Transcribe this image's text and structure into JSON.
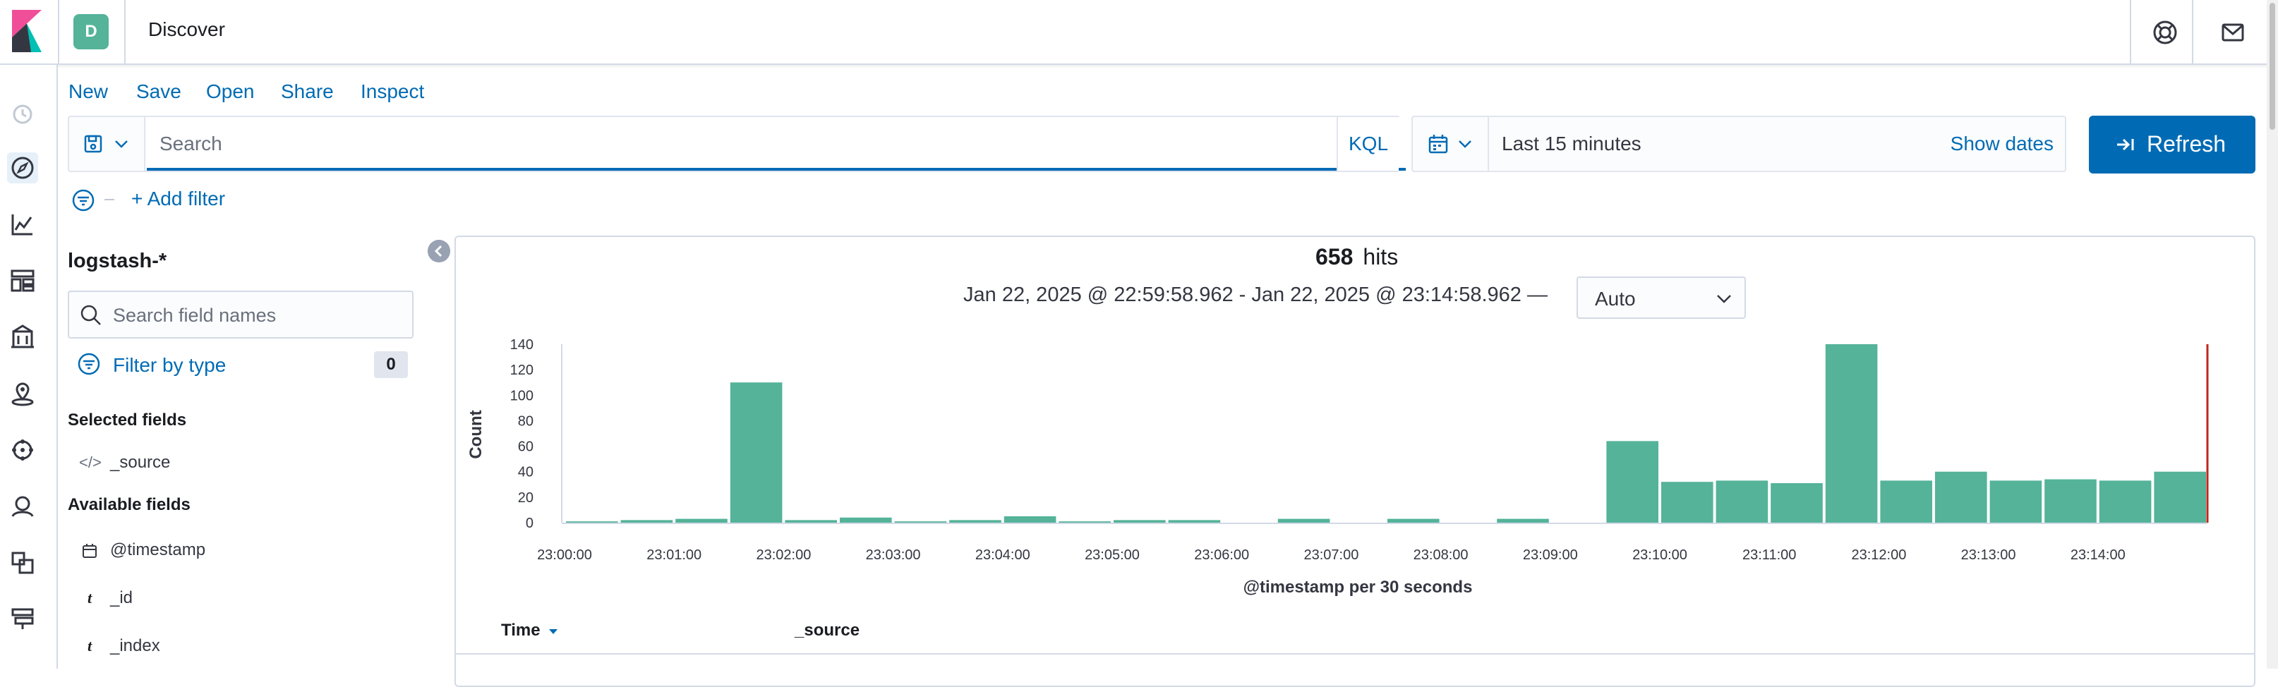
{
  "header": {
    "space_initial": "D",
    "app_title": "Discover",
    "icons": [
      "kibana-logo-icon",
      "help-icon",
      "newsfeed-icon"
    ]
  },
  "nav": {
    "icons": [
      "recently-viewed-icon",
      "discover-icon",
      "visualize-icon",
      "dashboard-icon",
      "canvas-icon",
      "maps-icon",
      "ml-icon",
      "siem-icon",
      "apm-icon",
      "infrastructure-icon"
    ],
    "active": "discover-icon"
  },
  "toolbar": {
    "new": "New",
    "save": "Save",
    "open": "Open",
    "share": "Share",
    "inspect": "Inspect"
  },
  "query": {
    "placeholder": "Search",
    "language": "KQL"
  },
  "datepicker": {
    "range": "Last 15 minutes",
    "show_dates": "Show dates"
  },
  "refresh_label": "Refresh",
  "filter": {
    "add_label": "+ Add filter"
  },
  "sidebar": {
    "index_pattern": "logstash-*",
    "search_placeholder": "Search field names",
    "filter_by_type": "Filter by type",
    "filter_count": "0",
    "selected_heading": "Selected fields",
    "selected_fields": [
      {
        "icon": "</>",
        "name": "_source"
      }
    ],
    "available_heading": "Available fields",
    "available_fields": [
      {
        "icon": "calendar",
        "name": "@timestamp"
      },
      {
        "icon": "t",
        "name": "_id"
      },
      {
        "icon": "t",
        "name": "_index"
      }
    ]
  },
  "results": {
    "hits_count": "658",
    "hits_label": "hits",
    "time_range": "Jan 22, 2025 @ 22:59:58.962 - Jan 22, 2025 @ 23:14:58.962 —",
    "interval": "Auto"
  },
  "table": {
    "col_time": "Time",
    "col_source": "_source"
  },
  "colors": {
    "accent": "#006bb4",
    "bar": "#54b399",
    "now_line": "#bd271e"
  },
  "chart_data": {
    "type": "bar",
    "xlabel": "@timestamp per 30 seconds",
    "ylabel": "Count",
    "ylim": [
      0,
      140
    ],
    "yticks": [
      0,
      20,
      40,
      60,
      80,
      100,
      120,
      140
    ],
    "xticks": [
      "23:00:00",
      "23:01:00",
      "23:02:00",
      "23:03:00",
      "23:04:00",
      "23:05:00",
      "23:06:00",
      "23:07:00",
      "23:08:00",
      "23:09:00",
      "23:10:00",
      "23:11:00",
      "23:12:00",
      "23:13:00",
      "23:14:00"
    ],
    "categories": [
      "23:00:00",
      "23:00:30",
      "23:01:00",
      "23:01:30",
      "23:02:00",
      "23:02:30",
      "23:03:00",
      "23:03:30",
      "23:04:00",
      "23:04:30",
      "23:05:00",
      "23:05:30",
      "23:06:00",
      "23:06:30",
      "23:07:00",
      "23:07:30",
      "23:08:00",
      "23:08:30",
      "23:09:00",
      "23:09:30",
      "23:10:00",
      "23:10:30",
      "23:11:00",
      "23:11:30",
      "23:12:00",
      "23:12:30",
      "23:13:00",
      "23:13:30",
      "23:14:00",
      "23:14:30"
    ],
    "values": [
      1,
      2,
      3,
      110,
      2,
      4,
      1,
      2,
      5,
      1,
      2,
      2,
      0,
      3,
      0,
      3,
      0,
      3,
      0,
      64,
      32,
      33,
      31,
      140,
      33,
      40,
      33,
      34,
      33,
      40
    ],
    "grid": false,
    "now_marker": "23:14:58.962"
  }
}
